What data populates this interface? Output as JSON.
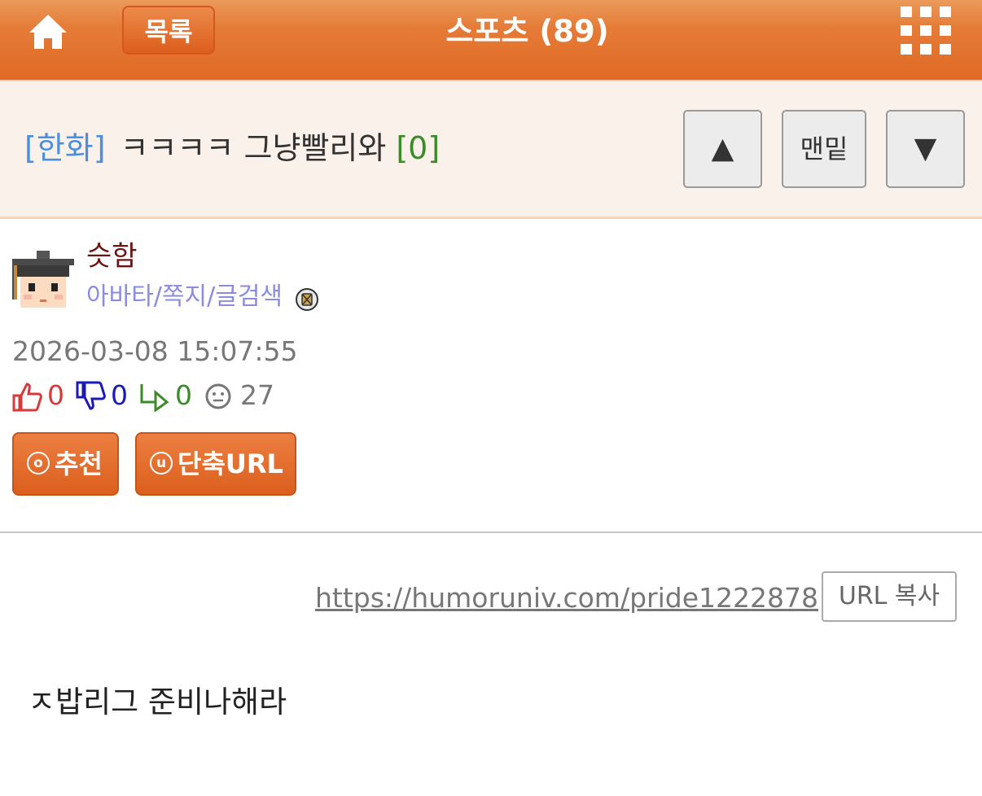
{
  "header": {
    "home_icon": "home-icon",
    "list_button": "목록",
    "board_title": "스포츠 (89)",
    "menu_icon": "grid-menu-icon",
    "background_color": "#e3712d"
  },
  "post_header": {
    "category": "[한화]",
    "title": "ㅋㅋㅋㅋ 그냥빨리와",
    "comment_count": "[0]",
    "nav": {
      "up_label": "▲",
      "bottom_label": "맨밑",
      "down_label": "▼"
    }
  },
  "author": {
    "avatar_icon": "graduate-avatar-icon",
    "name": "슷함",
    "links": "아바타/쪽지/글검색",
    "badge_icon": "member-badge-icon"
  },
  "post_meta": {
    "datetime": "2026-03-08 15:07:55",
    "stats": [
      {
        "icon": "thumbs-up-icon",
        "value": "0",
        "color": "#d83a3a"
      },
      {
        "icon": "thumbs-down-icon",
        "value": "0",
        "color": "#1a1ab8"
      },
      {
        "icon": "reply-arrow-icon",
        "value": "0",
        "color": "#3c8a2a"
      },
      {
        "icon": "views-face-icon",
        "value": "27",
        "color": "#777777"
      }
    ]
  },
  "actions": {
    "recommend_symbol": "o",
    "recommend_label": "추천",
    "short_url_symbol": "u",
    "short_url_label": "단축URL"
  },
  "url_bar": {
    "url": "https://humoruniv.com/pride1222878",
    "copy_label": "URL 복사"
  },
  "content": {
    "body": "ㅈ밥리그 준비나해라"
  }
}
